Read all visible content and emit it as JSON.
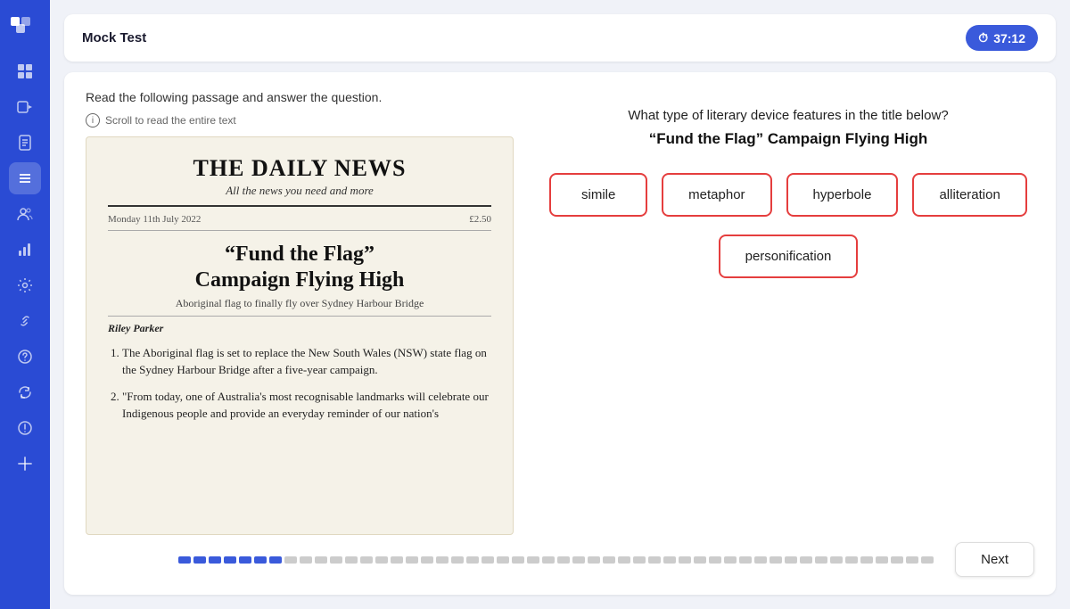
{
  "app": {
    "title": "Mock Test",
    "timer": "37:12"
  },
  "sidebar": {
    "icons": [
      {
        "name": "grid-icon",
        "symbol": "⊞",
        "active": false
      },
      {
        "name": "video-icon",
        "symbol": "▶",
        "active": false
      },
      {
        "name": "document-icon",
        "symbol": "📄",
        "active": false
      },
      {
        "name": "list-icon",
        "symbol": "☰",
        "active": true
      },
      {
        "name": "users-icon",
        "symbol": "👥",
        "active": false
      },
      {
        "name": "chart-icon",
        "symbol": "📊",
        "active": false
      },
      {
        "name": "settings-icon",
        "symbol": "⚙",
        "active": false
      },
      {
        "name": "link-icon",
        "symbol": "🔗",
        "active": false
      },
      {
        "name": "help-icon",
        "symbol": "?",
        "active": false
      },
      {
        "name": "refresh-icon",
        "symbol": "↺",
        "active": false
      },
      {
        "name": "alert-icon",
        "symbol": "!",
        "active": false
      },
      {
        "name": "plus-icon",
        "symbol": "+",
        "active": false
      }
    ]
  },
  "header": {
    "title": "Mock Test",
    "timer_label": "37:12"
  },
  "passage": {
    "instruction": "Read the following passage and answer the question.",
    "scroll_hint": "Scroll to read the entire text",
    "newspaper": {
      "title": "THE DAILY NEWS",
      "subtitle": "All the news you need and more",
      "date": "Monday 11th July 2022",
      "price": "£2.50",
      "headline_line1": "“Fund the Flag”",
      "headline_line2": "Campaign Flying High",
      "subheadline": "Aboriginal flag to finally fly over Sydney Harbour Bridge",
      "author": "Riley Parker",
      "paragraphs": [
        "The Aboriginal flag is set to replace the New South Wales (NSW) state flag on the Sydney Harbour Bridge after a five-year campaign.",
        "“From today, one of Australia’s most recognisable landmarks will celebrate our Indigenous people and provide an everyday reminder of our nation’s"
      ]
    }
  },
  "question": {
    "text": "What type of literary device features in the title below?",
    "title": "“Fund the Flag” Campaign Flying High",
    "options": [
      {
        "id": "simile",
        "label": "simile"
      },
      {
        "id": "metaphor",
        "label": "metaphor"
      },
      {
        "id": "hyperbole",
        "label": "hyperbole"
      },
      {
        "id": "alliteration",
        "label": "alliteration"
      },
      {
        "id": "personification",
        "label": "personification"
      }
    ]
  },
  "footer": {
    "next_label": "Next",
    "progress_completed": 7,
    "progress_total": 50
  }
}
